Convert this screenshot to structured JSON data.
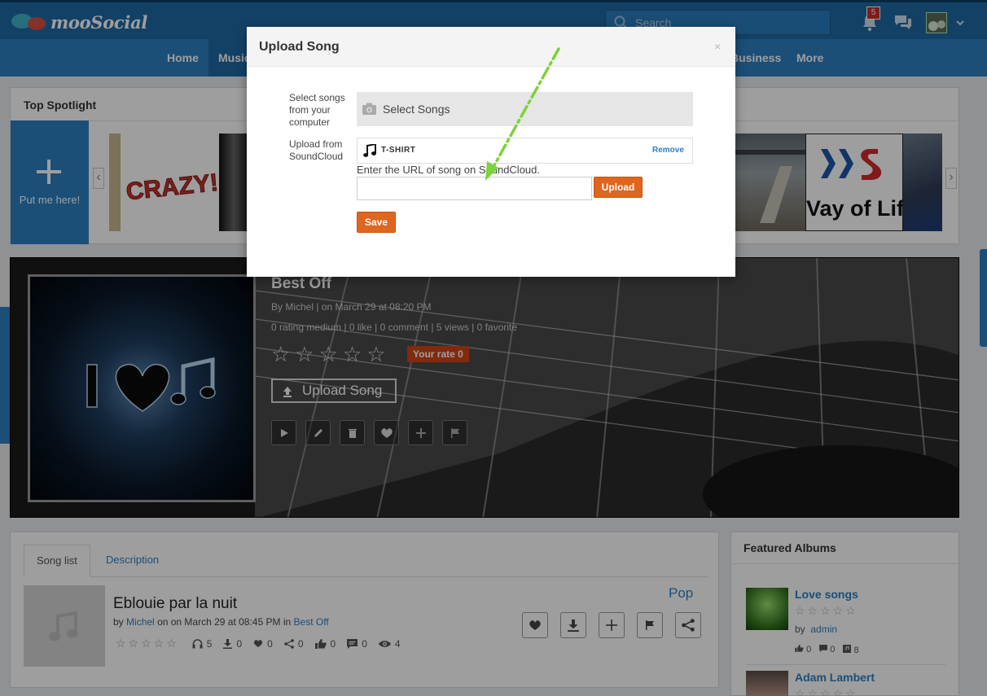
{
  "app": {
    "logo_text": "mooSocial"
  },
  "header": {
    "search_placeholder": "Search",
    "notification_count": "5"
  },
  "nav": {
    "items": [
      "Home",
      "Music",
      "Business",
      "More"
    ]
  },
  "spotlight": {
    "title": "Top Spotlight",
    "add_label": "Put me here!",
    "prev": "‹",
    "next": "›",
    "thumb_texts": [
      "CRAZY!",
      "Vay of Life"
    ]
  },
  "album": {
    "title": "Best Off",
    "meta": "By Michel  |  on March 29 at 08:20 PM",
    "stats": "0 rating medium | 0 like | 0 comment | 5 views | 0 favorite",
    "stars": "☆☆☆☆☆",
    "your_rate": "Your rate 0",
    "upload_button": "Upload Song"
  },
  "song_list": {
    "tabs": [
      "Song list",
      "Description"
    ],
    "song": {
      "title": "Eblouie par la nuit",
      "by_prefix": "by",
      "author": "Michel",
      "date": "on on March 29 at 08:45 PM in",
      "album": "Best Off",
      "genre": "Pop",
      "stars": "☆☆☆☆☆",
      "listens": "5",
      "downloads": "0",
      "likes": "0",
      "shares": "0",
      "thumbs": "0",
      "comments": "0",
      "views": "4"
    }
  },
  "featured": {
    "title": "Featured Albums",
    "items": [
      {
        "title": "Love songs",
        "stars": "☆☆☆☆☆",
        "by_prefix": "by",
        "author": "admin",
        "likes": "0",
        "comments": "0",
        "songs": "8"
      },
      {
        "title": "Adam Lambert",
        "stars": "☆☆☆☆☆"
      }
    ]
  },
  "modal": {
    "title": "Upload Song",
    "close": "×",
    "select_label": "Select songs from your computer",
    "select_button": "Select Songs",
    "soundcloud_label": "Upload from SoundCloud",
    "soundcloud_track": "T-SHIRT",
    "remove": "Remove",
    "url_hint": "Enter the URL of song on SoundCloud.",
    "url_value": "",
    "upload_button": "Upload",
    "save_button": "Save"
  },
  "colors": {
    "brand": "#2d80c2",
    "brand_dark": "#1f6aa5",
    "accent": "#e0651f",
    "arrow": "#7ed23a"
  }
}
